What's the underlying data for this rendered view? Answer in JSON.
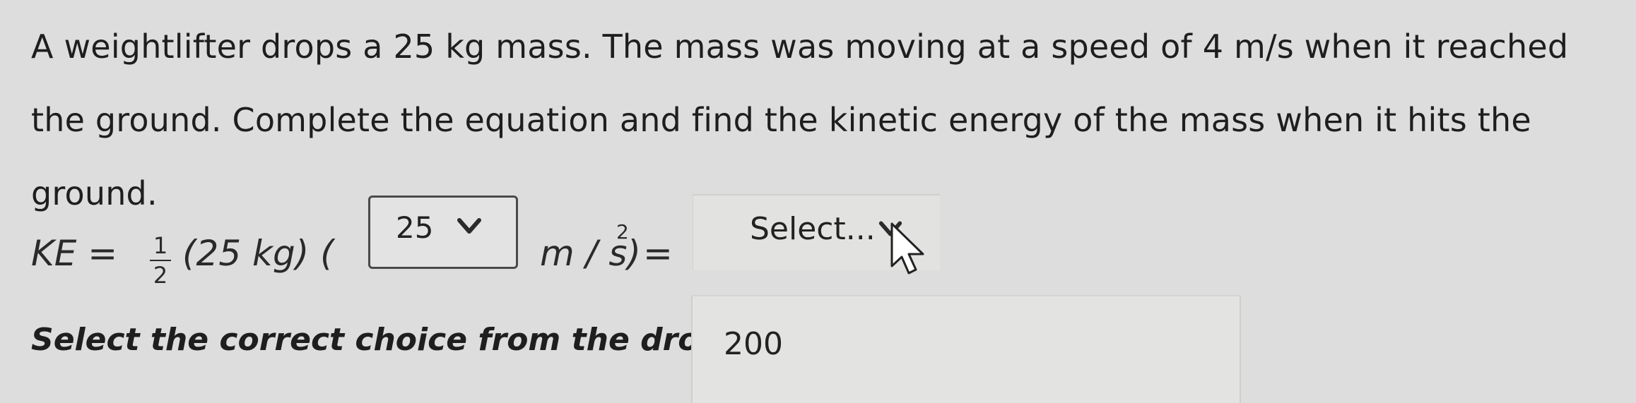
{
  "question": {
    "text": "A weightlifter drops a 25 kg mass. The mass was moving at a speed of 4 m/s when it reached the ground. Complete the equation and find the kinetic energy of the mass when it hits the ground."
  },
  "equation": {
    "lhs": "KE =",
    "fraction_numerator": "1",
    "fraction_denominator": "2",
    "mass_term": "(25  kg) (",
    "speed_unit": "m / s)",
    "exponent": "2",
    "equals": "="
  },
  "speed_select": {
    "value": "25",
    "icon": "chevron-down-icon"
  },
  "energy_select": {
    "value": "Select...",
    "icon": "chevron-down-icon"
  },
  "energy_options": {
    "visible_option": "200"
  },
  "instruction": {
    "text": "Select the correct choice from the dro"
  },
  "cursor": {
    "icon": "mouse-pointer-icon"
  }
}
